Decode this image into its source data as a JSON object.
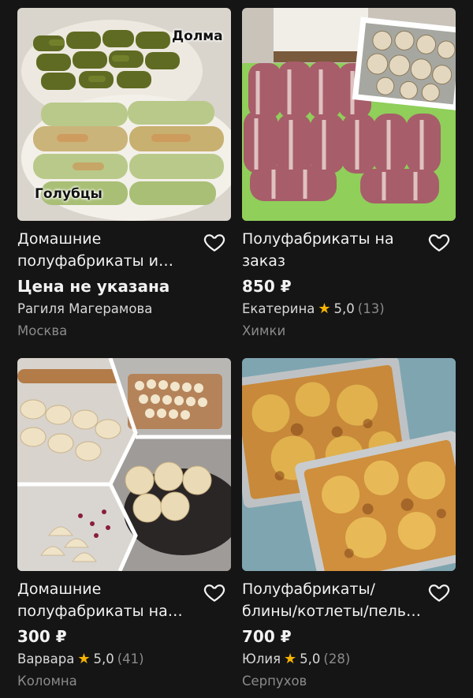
{
  "listings": [
    {
      "title": "Домашние полуфабрикаты и вы…",
      "price": "Цена не указана",
      "seller": "Рагиля Магерамова",
      "rating": "",
      "reviews": "",
      "city": "Москва",
      "image_labels": [
        "Долма",
        "Голубцы"
      ]
    },
    {
      "title": "Полуфабрикаты на заказ",
      "price": "850 ₽",
      "seller": "Екатерина",
      "rating": "5,0",
      "reviews": "(13)",
      "city": "Химки"
    },
    {
      "title": "Домашние полуфабрикаты на за…",
      "price": "300 ₽",
      "seller": "Варвара",
      "rating": "5,0",
      "reviews": "(41)",
      "city": "Коломна"
    },
    {
      "title": "Полуфабрикаты/ блины/котлеты/пель…",
      "price": "700 ₽",
      "seller": "Юлия",
      "rating": "5,0",
      "reviews": "(28)",
      "city": "Серпухов"
    }
  ],
  "icons": {
    "favorite": "heart-outline-icon",
    "rating": "star-icon"
  },
  "colors": {
    "background": "#151515",
    "star": "#f5b400",
    "muted": "#8a8a8a"
  }
}
